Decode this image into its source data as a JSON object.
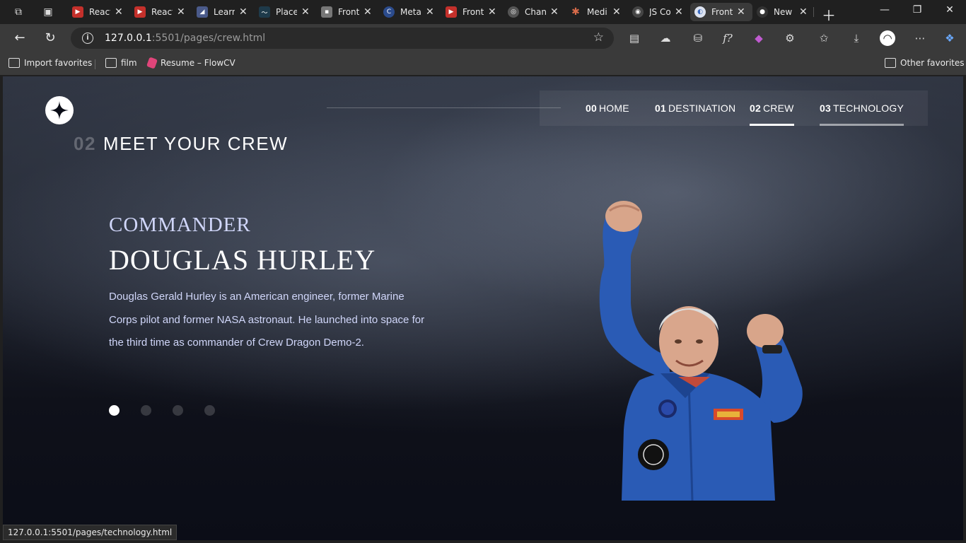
{
  "browser": {
    "tabs": [
      {
        "title": "React",
        "fav_color": "#c4302b",
        "fav_glyph": "▶"
      },
      {
        "title": "React",
        "fav_color": "#c4302b",
        "fav_glyph": "▶"
      },
      {
        "title": "Learn",
        "fav_color": "#4a5a8a",
        "fav_glyph": "◢"
      },
      {
        "title": "Place",
        "fav_color": "#1e3a4a",
        "fav_glyph": "〜"
      },
      {
        "title": "Front",
        "fav_color": "#777777",
        "fav_glyph": "▪"
      },
      {
        "title": "Meta",
        "fav_color": "#2b4b8c",
        "fav_glyph": "C"
      },
      {
        "title": "Front",
        "fav_color": "#c4302b",
        "fav_glyph": "▶"
      },
      {
        "title": "Chan",
        "fav_color": "#555555",
        "fav_glyph": "◎"
      },
      {
        "title": "Medi",
        "fav_color": "#3a2020",
        "fav_glyph": "✱"
      },
      {
        "title": "JS Co",
        "fav_color": "#444444",
        "fav_glyph": "◉"
      },
      {
        "title": "Front",
        "fav_color": "#dde3f0",
        "fav_glyph": "◐"
      },
      {
        "title": "New",
        "fav_color": "#333333",
        "fav_glyph": "●"
      }
    ],
    "active_tab_index": 10,
    "url_host": "127.0.0.1",
    "url_path": ":5501/pages/crew.html",
    "bookmarks": [
      "Import favorites",
      "film",
      "Resume – FlowCV"
    ],
    "other_favorites": "Other favorites",
    "status_url": "127.0.0.1:5501/pages/technology.html"
  },
  "site": {
    "nav": [
      {
        "num": "00",
        "label": "HOME"
      },
      {
        "num": "01",
        "label": "DESTINATION"
      },
      {
        "num": "02",
        "label": "CREW"
      },
      {
        "num": "03",
        "label": "TECHNOLOGY"
      }
    ],
    "active_nav_index": 2,
    "hover_nav_index": 3,
    "heading_num": "02",
    "heading_text": "MEET YOUR CREW",
    "crew": {
      "role": "COMMANDER",
      "name": "DOUGLAS HURLEY",
      "bio": "Douglas Gerald Hurley is an American engineer, former Marine Corps pilot and former NASA astronaut. He launched into space for the third time as commander of Crew Dragon Demo-2."
    },
    "slider_count": 4,
    "slider_active_index": 0
  }
}
